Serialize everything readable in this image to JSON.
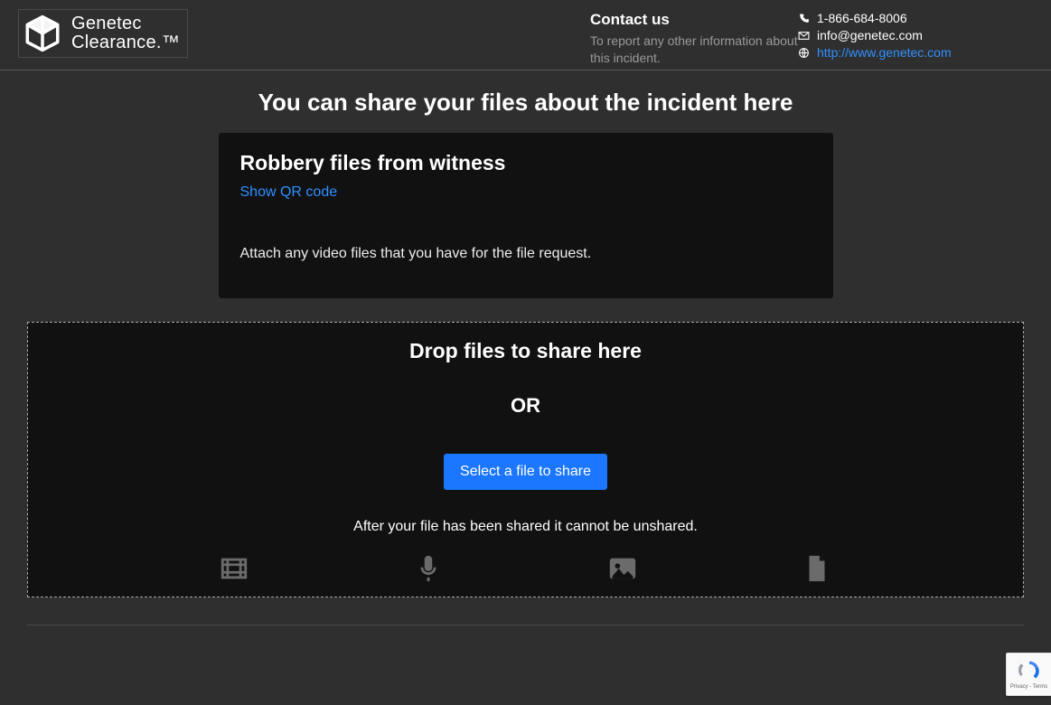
{
  "brand": {
    "line1": "Genetec",
    "line2": "Clearance.™"
  },
  "header": {
    "contact_title": "Contact us",
    "contact_desc": "To report any other information about this incident.",
    "phone": "1-866-684-8006",
    "email": "info@genetec.com",
    "url": "http://www.genetec.com"
  },
  "page": {
    "title": "You can share your files about the incident here"
  },
  "card": {
    "title": "Robbery files from witness",
    "qr_link": "Show QR code",
    "desc": "Attach any video files that you have for the file request."
  },
  "dropzone": {
    "title": "Drop files to share here",
    "or": "OR",
    "button": "Select a file to share",
    "note": "After your file has been shared it cannot be unshared."
  },
  "recaptcha": {
    "privacy": "Privacy",
    "terms": "Terms"
  }
}
